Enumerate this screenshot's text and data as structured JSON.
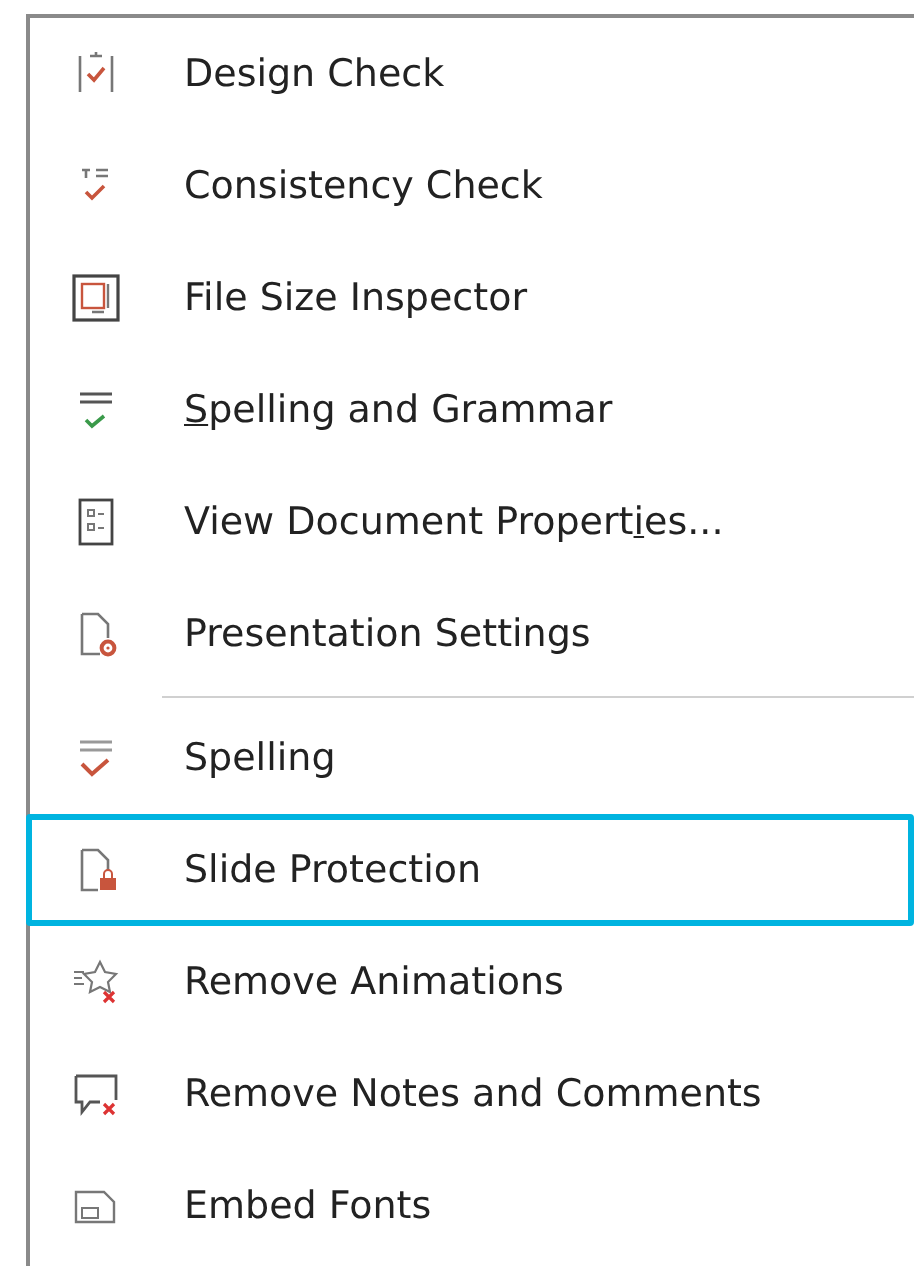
{
  "menu": {
    "items": [
      {
        "kind": "item",
        "label_before": "Design Check",
        "selected": false
      },
      {
        "kind": "item",
        "label_before": "Consistency Check",
        "selected": false
      },
      {
        "kind": "item",
        "label_before": "File Size Inspector",
        "selected": false
      },
      {
        "kind": "item",
        "access_key": "S",
        "label_after": "pelling and Grammar",
        "selected": false
      },
      {
        "kind": "item",
        "label_before": "View Document Propert",
        "access_key": "i",
        "label_after": "es...",
        "selected": false
      },
      {
        "kind": "item",
        "label_before": "Presentation Settings",
        "selected": false
      },
      {
        "kind": "separator"
      },
      {
        "kind": "item",
        "label_before": "Spelling",
        "selected": false
      },
      {
        "kind": "item",
        "label_before": "Slide Protection",
        "selected": true
      },
      {
        "kind": "item",
        "label_before": "Remove Animations",
        "selected": false
      },
      {
        "kind": "item",
        "label_before": "Remove Notes and Comments",
        "selected": false
      },
      {
        "kind": "item",
        "label_before": "Embed Fonts",
        "selected": false
      }
    ]
  }
}
